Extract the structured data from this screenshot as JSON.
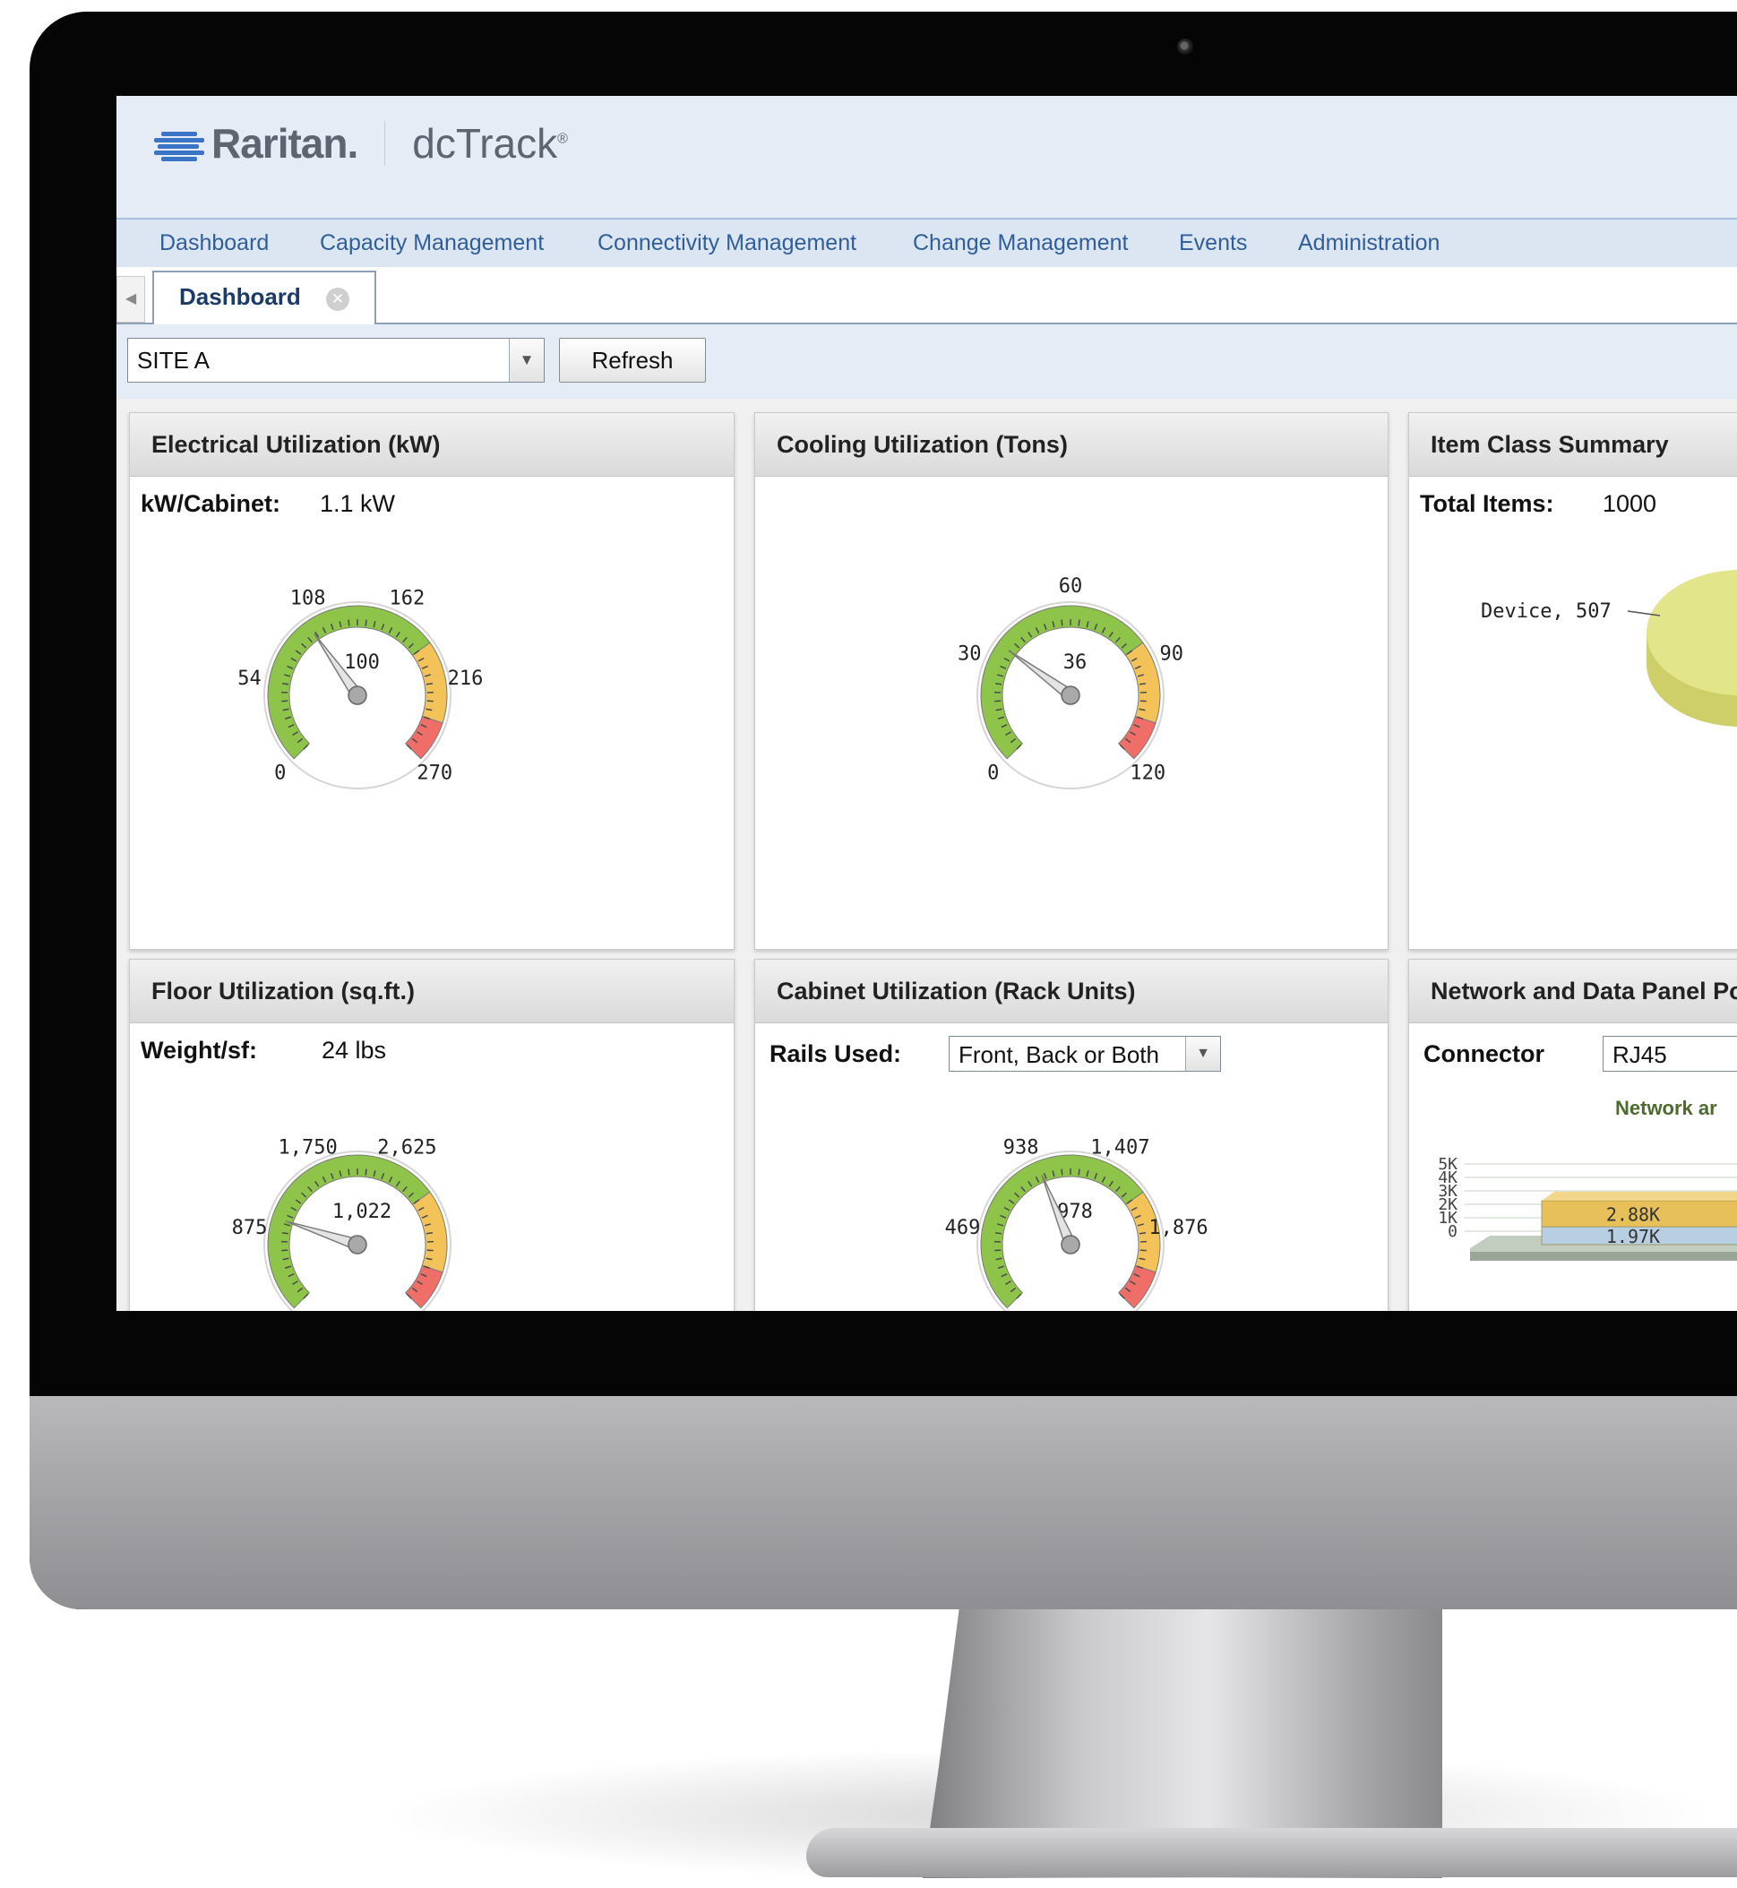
{
  "header": {
    "brand": "Raritan.",
    "product": "dcTrack",
    "registered": "®"
  },
  "nav": [
    "Dashboard",
    "Capacity Management",
    "Connectivity Management",
    "Change Management",
    "Events",
    "Administration"
  ],
  "tabs": [
    {
      "label": "Dashboard",
      "active": true
    }
  ],
  "toolbar": {
    "site_value": "SITE A",
    "refresh_label": "Refresh"
  },
  "panels": {
    "electrical": {
      "title": "Electrical Utilization (kW)",
      "metric_label": "kW/Cabinet:",
      "metric_value": "1.1 kW",
      "gauge": {
        "min": 0,
        "max": 270,
        "value": 100,
        "value_label": "100",
        "ticks": [
          "0",
          "54",
          "108",
          "162",
          "216",
          "270"
        ],
        "bands": [
          {
            "from": 0,
            "to": 189,
            "color": "#8fc44a"
          },
          {
            "from": 189,
            "to": 243,
            "color": "#f3c35a"
          },
          {
            "from": 243,
            "to": 270,
            "color": "#ef6e67"
          }
        ]
      }
    },
    "cooling": {
      "title": "Cooling Utilization (Tons)",
      "gauge": {
        "min": 0,
        "max": 120,
        "value": 36,
        "value_label": "36",
        "ticks": [
          "0",
          "30",
          "60",
          "90",
          "120"
        ],
        "bands": [
          {
            "from": 0,
            "to": 84,
            "color": "#8fc44a"
          },
          {
            "from": 84,
            "to": 108,
            "color": "#f3c35a"
          },
          {
            "from": 108,
            "to": 120,
            "color": "#ef6e67"
          }
        ]
      }
    },
    "item_class": {
      "title": "Item Class Summary",
      "metric_label": "Total Items:",
      "metric_value": "1000",
      "pie_slice": {
        "label": "Device, 507",
        "value": 507,
        "color": "#e3e58a"
      }
    },
    "floor": {
      "title": "Floor Utilization (sq.ft.)",
      "metric_label": "Weight/sf:",
      "metric_value": "24 lbs",
      "gauge": {
        "min": 0,
        "max": 4375,
        "value": 1022,
        "value_label": "1,022",
        "ticks": [
          "875",
          "1,750",
          "2,625"
        ],
        "tick_values": [
          875,
          1750,
          2625
        ],
        "bands": [
          {
            "from": 0,
            "to": 3063,
            "color": "#8fc44a"
          },
          {
            "from": 3063,
            "to": 3938,
            "color": "#f3c35a"
          },
          {
            "from": 3938,
            "to": 4375,
            "color": "#ef6e67"
          }
        ]
      }
    },
    "cabinet": {
      "title": "Cabinet Utilization (Rack Units)",
      "rails_label": "Rails Used:",
      "rails_value": "Front, Back or Both",
      "gauge": {
        "min": 0,
        "max": 2345,
        "value": 978,
        "value_label": "978",
        "ticks": [
          "469",
          "938",
          "1,407",
          "1,876"
        ],
        "tick_values": [
          469,
          938,
          1407,
          1876
        ],
        "bands": [
          {
            "from": 0,
            "to": 1642,
            "color": "#8fc44a"
          },
          {
            "from": 1642,
            "to": 2110,
            "color": "#f3c35a"
          },
          {
            "from": 2110,
            "to": 2345,
            "color": "#ef6e67"
          }
        ]
      }
    },
    "network": {
      "title": "Network and Data Panel Po",
      "connector_label": "Connector",
      "connector_value": "RJ45",
      "chart_data": {
        "type": "bar",
        "title": "Network ar",
        "y_ticks": [
          "5K",
          "4K",
          "3K",
          "2K",
          "1K",
          "0"
        ],
        "bars": [
          {
            "label": "2.88K",
            "value": 2880,
            "color": "#e8c05a"
          },
          {
            "label": "1.97K",
            "value": 1970,
            "color": "#b8cfe3"
          }
        ]
      }
    }
  }
}
